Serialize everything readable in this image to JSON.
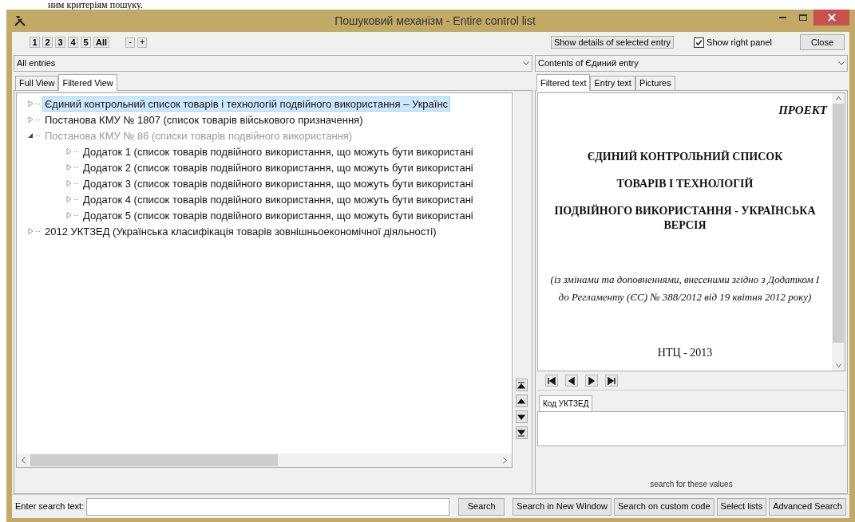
{
  "background_text": "ним критеріям пошуку.",
  "window": {
    "title": "Пошуковий механізм - Entire control list"
  },
  "toolbar": {
    "level_buttons": [
      "1",
      "2",
      "3",
      "4",
      "5",
      "All"
    ],
    "zoom_buttons": [
      "-",
      "+"
    ],
    "details_button": "Show details of selected entry",
    "show_right_panel": {
      "label": "Show right panel",
      "checked": true
    },
    "close_button": "Close"
  },
  "left_panel": {
    "filter_dropdown": "All entries",
    "tabs": [
      {
        "label": "Full View",
        "selected": false
      },
      {
        "label": "Filtered View",
        "selected": true
      }
    ],
    "tree": [
      {
        "label": "Єдиний контрольний список товарів і технологій подвійного використання – Українс",
        "selected": true,
        "greyed": false,
        "expanded": false
      },
      {
        "label": "Постанова КМУ № 1807 (список товарів військового призначення)",
        "selected": false,
        "greyed": false,
        "expanded": false
      },
      {
        "label": "Постанова КМУ № 86 (списки товарів подвійного використання)",
        "selected": false,
        "greyed": true,
        "expanded": true,
        "children": [
          {
            "label": "Додаток 1 (список товарів подвійного використання, що можуть бути використані",
            "selected": false,
            "greyed": false,
            "expanded": false
          },
          {
            "label": "Додаток 2 (список товарів подвійного використання, що можуть бути використані",
            "selected": false,
            "greyed": false,
            "expanded": false
          },
          {
            "label": "Додаток 3 (список товарів подвійного використання, що можуть бути використані",
            "selected": false,
            "greyed": false,
            "expanded": false
          },
          {
            "label": "Додаток 4 (список товарів подвійного використання, що можуть бути використані",
            "selected": false,
            "greyed": false,
            "expanded": false
          },
          {
            "label": "Додаток 5 (список товарів подвійного використання, що можуть бути використані",
            "selected": false,
            "greyed": false,
            "expanded": false
          }
        ]
      },
      {
        "label": "2012 УКТЗЕД (Українська класифікація товарів зовнішньоекономічної діяльності)",
        "selected": false,
        "greyed": false,
        "expanded": false
      }
    ]
  },
  "right_panel": {
    "contents_dropdown": "Contents of Єдиний entry",
    "tabs": [
      {
        "label": "Filtered text",
        "selected": true
      },
      {
        "label": "Entry text",
        "selected": false
      },
      {
        "label": "Pictures",
        "selected": false
      }
    ],
    "document": [
      {
        "kind": "stamp",
        "text": "ПРОЕКТ"
      },
      {
        "kind": "heading",
        "text": "ЄДИНИЙ КОНТРОЛЬНИЙ СПИСОК"
      },
      {
        "kind": "heading",
        "text": "ТОВАРІВ І ТЕХНОЛОГІЙ"
      },
      {
        "kind": "heading",
        "text": "ПОДВІЙНОГО ВИКОРИСТАННЯ - УКРАЇНСЬКА ВЕРСІЯ"
      },
      {
        "kind": "note",
        "text": "(із змінами та доповненнями, внесеними згідно з Додатком I до Регламенту (ЄС) № 388/2012 від 19 квітня  2012 року)"
      },
      {
        "kind": "footer",
        "text": "НТЦ - 2013"
      }
    ],
    "code_tab": "Код УКТЗЕД",
    "search_values_label": "search for these values"
  },
  "search_bar": {
    "label": "Enter search text:",
    "search_button": "Search",
    "buttons": [
      "Search in New Window",
      "Search on custom code",
      "Select lists",
      "Advanced Search"
    ]
  }
}
